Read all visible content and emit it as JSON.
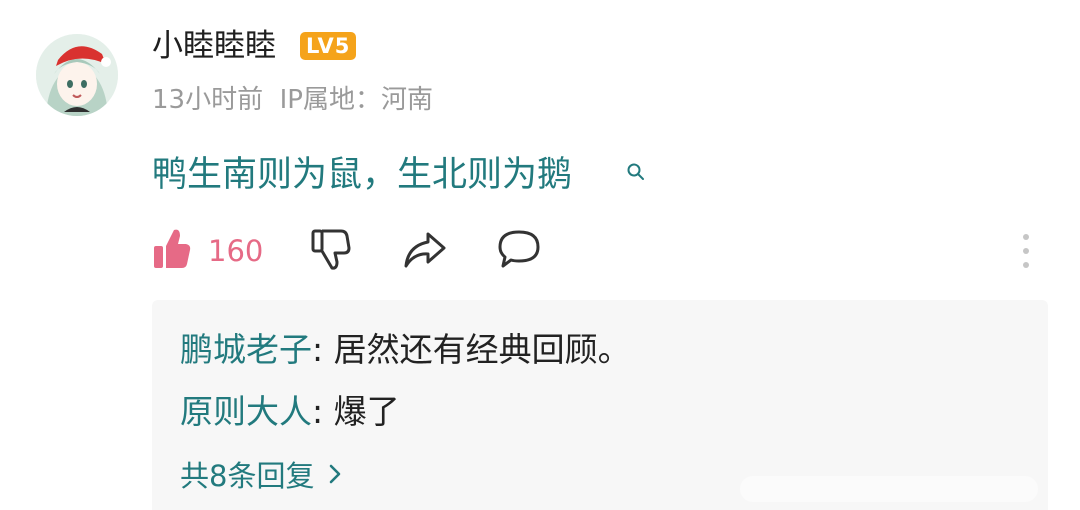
{
  "comment": {
    "username": "小睦睦睦",
    "level_badge": "LV5",
    "time_ago": "13小时前",
    "ip_label": "IP属地：",
    "ip_location": "河南",
    "text": "鸭生南则为鼠，生北则为鹅"
  },
  "actions": {
    "like_count": "160",
    "icons": [
      "thumbs-up-icon",
      "thumbs-down-icon",
      "share-icon",
      "comment-bubble-icon",
      "more-vertical-icon"
    ]
  },
  "replies": [
    {
      "author": "鹏城老子",
      "separator": ": ",
      "text": "居然还有经典回顾。"
    },
    {
      "author": "原则大人",
      "separator": ": ",
      "text": "爆了"
    }
  ],
  "more_replies_label": "共8条回复",
  "colors": {
    "link_teal": "#227a7e",
    "like_pink": "#e66a86",
    "badge_orange": "#f5a31a",
    "meta_gray": "#9a9a9a",
    "reply_bg": "#f7f7f7"
  }
}
